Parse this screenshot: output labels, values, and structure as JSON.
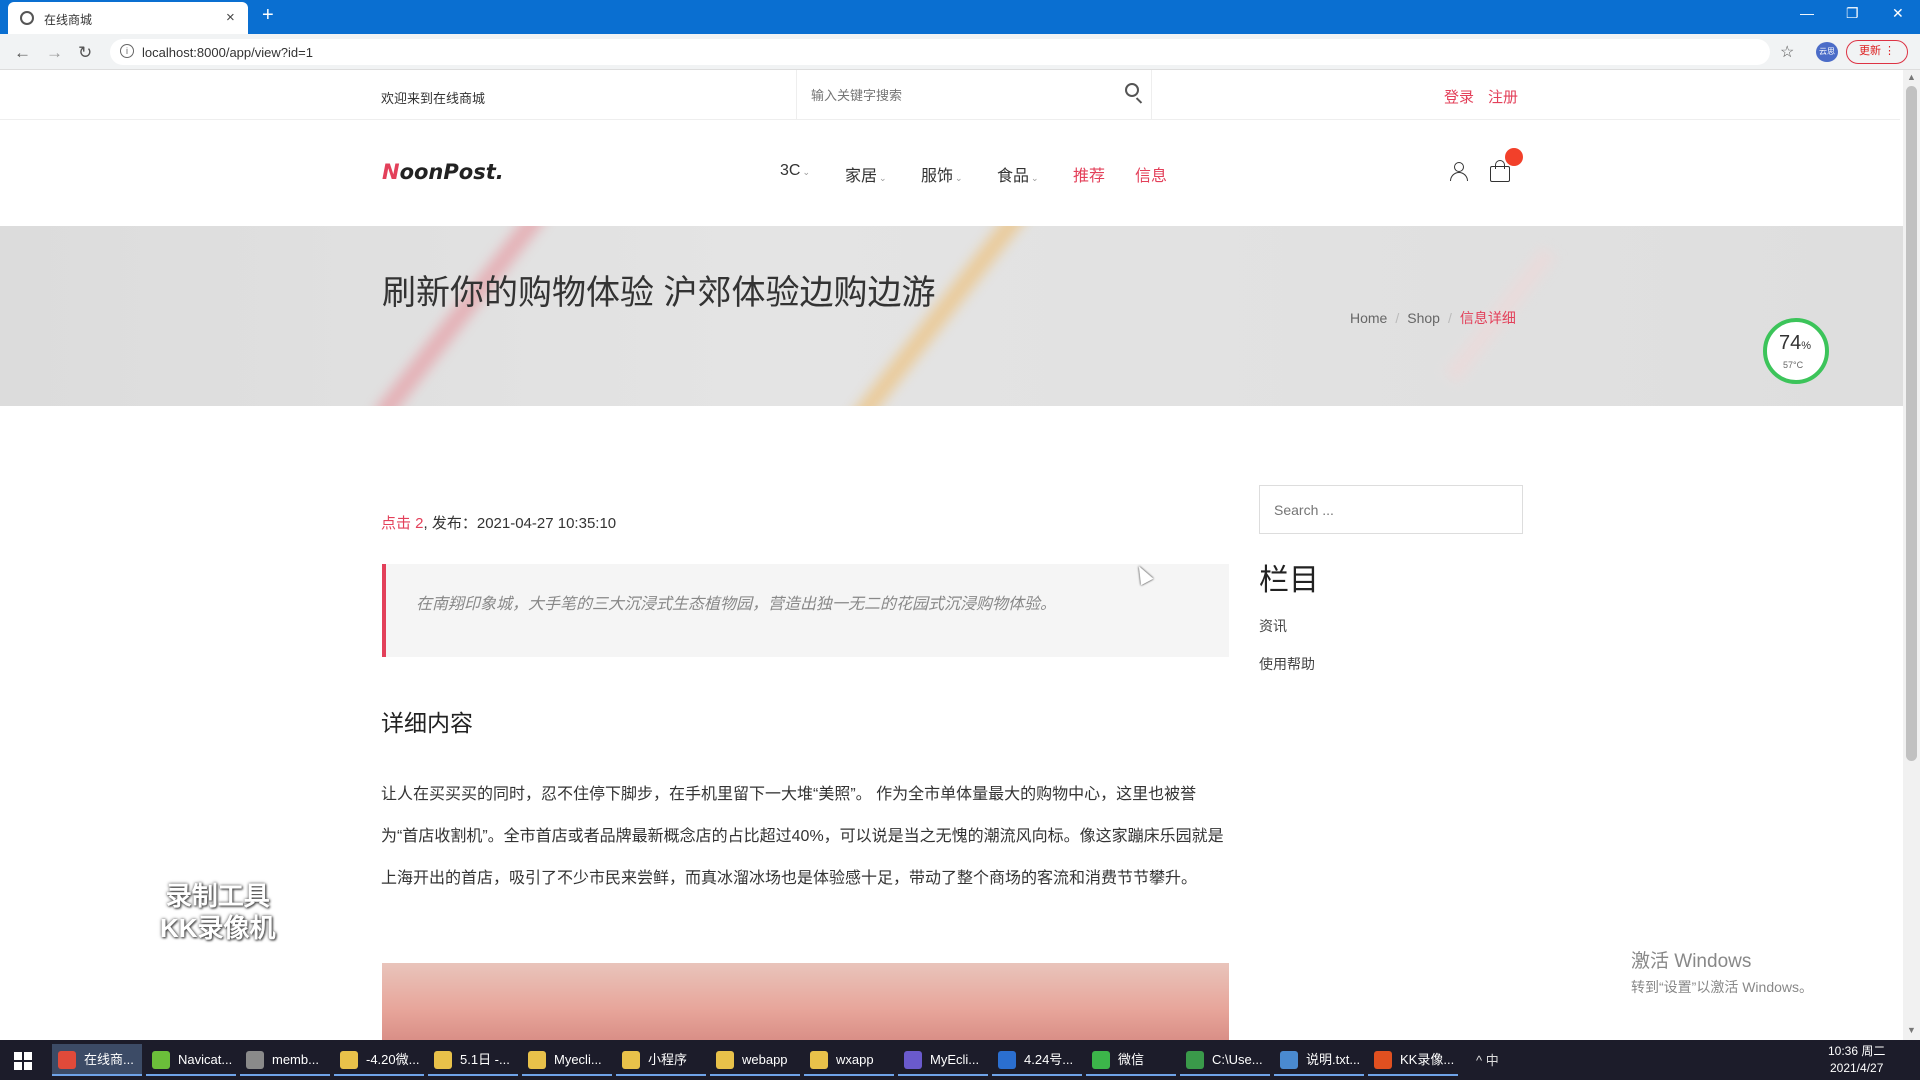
{
  "browser": {
    "tab_title": "在线商城",
    "tab_close": "×",
    "new_tab": "+",
    "url": "localhost:8000/app/view?id=1",
    "update_label": "更新",
    "profile": "云思"
  },
  "topbar": {
    "welcome": "欢迎来到在线商城",
    "search_placeholder": "输入关键字搜索",
    "login": "登录",
    "register": "注册"
  },
  "header": {
    "logo_first": "N",
    "logo_rest": "oonPost.",
    "menu": [
      {
        "label": "3C",
        "dropdown": true
      },
      {
        "label": "家居",
        "dropdown": true
      },
      {
        "label": "服饰",
        "dropdown": true
      },
      {
        "label": "食品",
        "dropdown": true
      },
      {
        "label": "推荐",
        "dropdown": false
      },
      {
        "label": "信息",
        "dropdown": false
      }
    ]
  },
  "banner": {
    "title": "刷新你的购物体验 沪郊体验边购边游",
    "breadcrumb": [
      "Home",
      "Shop",
      "信息详细"
    ]
  },
  "gauge": {
    "percent": "74",
    "unit": "%",
    "temp": "57°C"
  },
  "article": {
    "hits_label": "点击 2",
    "published": ", 发布：2021-04-27 10:35:10",
    "quote": "在南翔印象城，大手笔的三大沉浸式生态植物园，营造出独一无二的花园式沉浸购物体验。",
    "section_title": "详细内容",
    "body": "让人在买买买的同时，忍不住停下脚步，在手机里留下一大堆“美照”。 作为全市单体量最大的购物中心，这里也被誉为“首店收割机”。全市首店或者品牌最新概念店的占比超过40%，可以说是当之无愧的潮流风向标。像这家蹦床乐园就是上海开出的首店，吸引了不少市民来尝鲜，而真冰溜冰场也是体验感十足，带动了整个商场的客流和消费节节攀升。"
  },
  "sidebar": {
    "search_placeholder": "Search ...",
    "title": "栏目",
    "links": [
      "资讯",
      "使用帮助"
    ]
  },
  "watermark": {
    "line1": "录制工具",
    "line2": "KK录像机"
  },
  "activation": {
    "line1": "激活 Windows",
    "line2": "转到“设置”以激活 Windows。"
  },
  "taskbar": {
    "items": [
      {
        "label": "在线商...",
        "color": "#e04a3a"
      },
      {
        "label": "Navicat...",
        "color": "#6bbf3a"
      },
      {
        "label": "memb...",
        "color": "#8a8a8a"
      },
      {
        "label": "-4.20微...",
        "color": "#e8c14a"
      },
      {
        "label": "5.1日 -...",
        "color": "#e8c14a"
      },
      {
        "label": "Myecli...",
        "color": "#e8c14a"
      },
      {
        "label": "小程序",
        "color": "#e8c14a"
      },
      {
        "label": "webapp",
        "color": "#e8c14a"
      },
      {
        "label": "wxapp",
        "color": "#e8c14a"
      },
      {
        "label": "MyEcli...",
        "color": "#6a5acd"
      },
      {
        "label": "4.24号...",
        "color": "#2b6fd0"
      },
      {
        "label": "微信",
        "color": "#3cb54a"
      },
      {
        "label": "C:\\Use...",
        "color": "#3a9a4a"
      },
      {
        "label": "说明.txt...",
        "color": "#4a8ad0"
      },
      {
        "label": "KK录像...",
        "color": "#e05020"
      }
    ],
    "tray_text": "^  中",
    "time": "10:36 周二",
    "date": "2021/4/27"
  }
}
